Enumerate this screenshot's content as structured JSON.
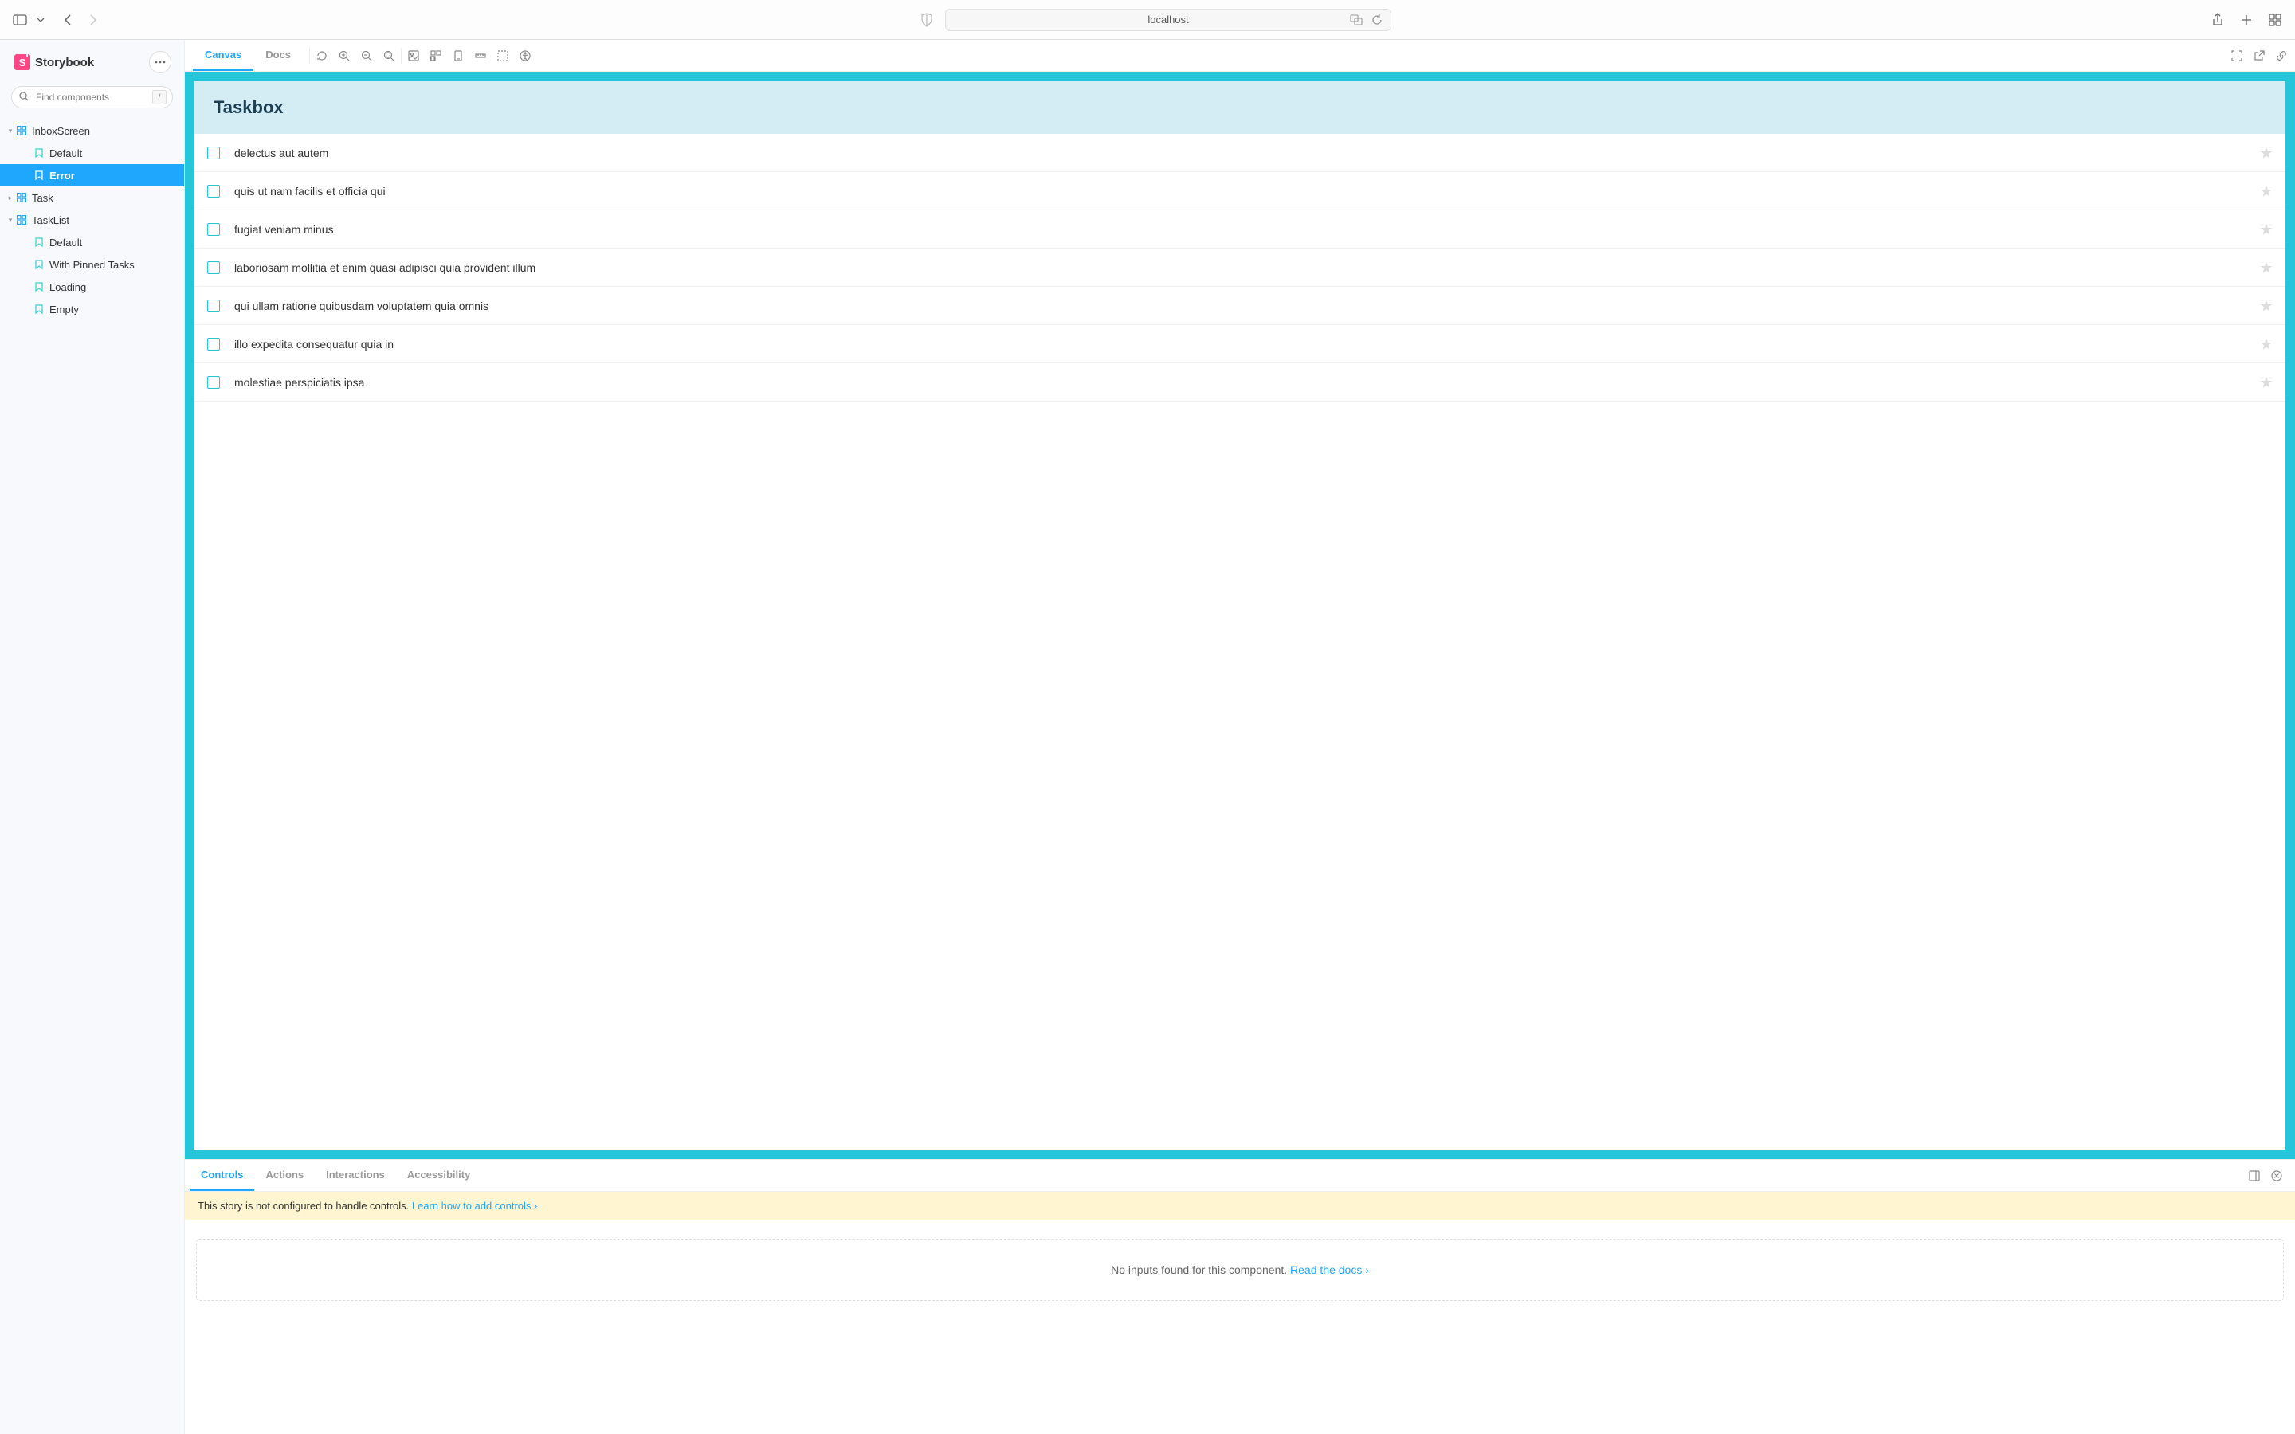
{
  "browser": {
    "url": "localhost"
  },
  "sidebar": {
    "brand": "Storybook",
    "search_placeholder": "Find components",
    "shortcut": "/",
    "tree": [
      {
        "label": "InboxScreen",
        "type": "component",
        "depth": 1,
        "expanded": true
      },
      {
        "label": "Default",
        "type": "story",
        "depth": 2,
        "selected": false
      },
      {
        "label": "Error",
        "type": "story",
        "depth": 2,
        "selected": true
      },
      {
        "label": "Task",
        "type": "component",
        "depth": 1,
        "expanded": false
      },
      {
        "label": "TaskList",
        "type": "component",
        "depth": 1,
        "expanded": true
      },
      {
        "label": "Default",
        "type": "story",
        "depth": 2,
        "selected": false
      },
      {
        "label": "With Pinned Tasks",
        "type": "story",
        "depth": 2,
        "selected": false
      },
      {
        "label": "Loading",
        "type": "story",
        "depth": 2,
        "selected": false
      },
      {
        "label": "Empty",
        "type": "story",
        "depth": 2,
        "selected": false
      }
    ]
  },
  "toolbar": {
    "tabs": [
      {
        "label": "Canvas",
        "active": true
      },
      {
        "label": "Docs",
        "active": false
      }
    ]
  },
  "preview": {
    "title": "Taskbox",
    "tasks": [
      {
        "title": "delectus aut autem"
      },
      {
        "title": "quis ut nam facilis et officia qui"
      },
      {
        "title": "fugiat veniam minus"
      },
      {
        "title": "laboriosam mollitia et enim quasi adipisci quia provident illum"
      },
      {
        "title": "qui ullam ratione quibusdam voluptatem quia omnis"
      },
      {
        "title": "illo expedita consequatur quia in"
      },
      {
        "title": "molestiae perspiciatis ipsa"
      }
    ]
  },
  "addons": {
    "tabs": [
      {
        "label": "Controls",
        "active": true
      },
      {
        "label": "Actions",
        "active": false
      },
      {
        "label": "Interactions",
        "active": false
      },
      {
        "label": "Accessibility",
        "active": false
      }
    ],
    "warning_text": "This story is not configured to handle controls. ",
    "warning_link": "Learn how to add controls",
    "empty_text": "No inputs found for this component. ",
    "empty_link": "Read the docs"
  }
}
